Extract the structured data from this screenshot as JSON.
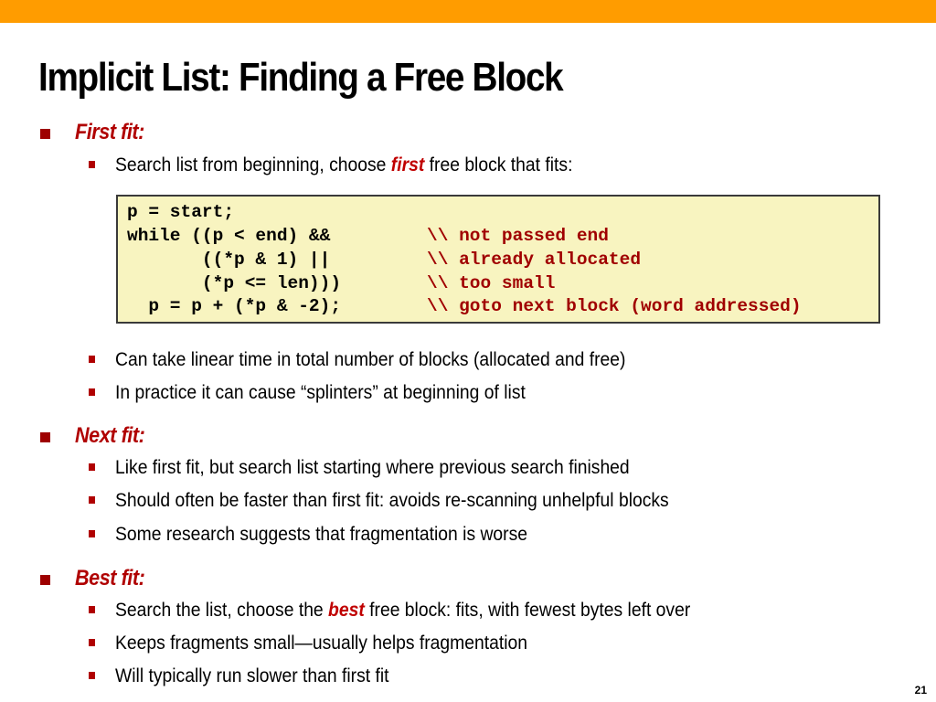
{
  "slide": {
    "title": "Implicit List: Finding a Free Block",
    "page_number": "21",
    "accent_color": "#ff9c00",
    "emphasis_color": "#c00000"
  },
  "sections": [
    {
      "heading": "First fit:",
      "bullets_before_code": [
        {
          "pre": "Search list from beginning, choose ",
          "em": "first",
          "post": " free block that fits:"
        }
      ],
      "code": [
        {
          "code": "p = start;",
          "comment": ""
        },
        {
          "code": "while ((p < end) &&",
          "comment": "\\\\ not passed end"
        },
        {
          "code": "       ((*p & 1) ||",
          "comment": "\\\\ already allocated"
        },
        {
          "code": "       (*p <= len)))",
          "comment": "\\\\ too small"
        },
        {
          "code": "  p = p + (*p & -2);",
          "comment": "\\\\ goto next block (word addressed)"
        }
      ],
      "bullets_after_code": [
        "Can take linear time in total number of blocks (allocated and free)",
        "In practice it can cause “splinters” at beginning of list"
      ]
    },
    {
      "heading": "Next fit:",
      "bullets": [
        "Like first fit, but search list starting where previous search finished",
        "Should often be faster than first fit: avoids re-scanning unhelpful blocks",
        "Some research suggests that fragmentation is worse"
      ]
    },
    {
      "heading": "Best fit:",
      "bullets_rich": [
        {
          "pre": "Search the list, choose the ",
          "em": "best",
          "post": " free block: fits, with fewest bytes left over"
        }
      ],
      "bullets": [
        "Keeps fragments small—usually helps fragmentation",
        "Will typically run slower than first fit"
      ]
    }
  ]
}
